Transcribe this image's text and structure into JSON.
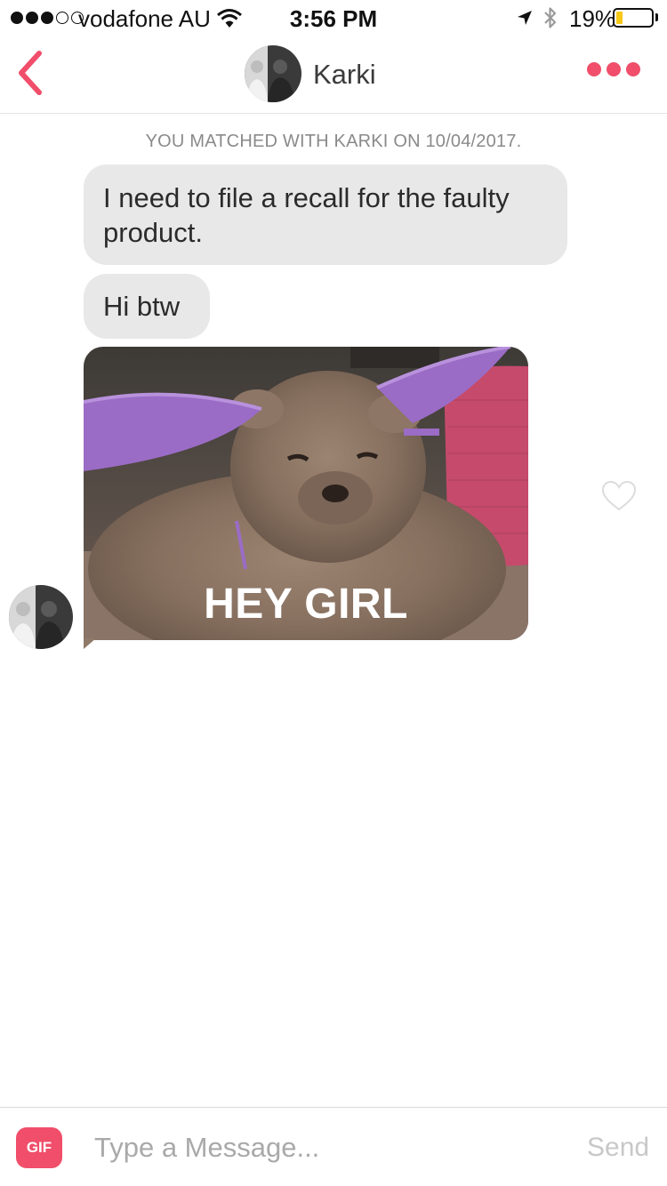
{
  "status_bar": {
    "carrier": "vodafone AU",
    "time": "3:56 PM",
    "battery_percent": "19%",
    "battery_level": 0.19,
    "signal_bars_filled": 3,
    "signal_bars_total": 5
  },
  "header": {
    "back_icon": "chevron-left-icon",
    "name": "Karki",
    "more_icon": "more-dots-icon"
  },
  "conversation": {
    "match_text": "YOU MATCHED WITH KARKI ON 10/04/2017.",
    "messages": [
      {
        "type": "text",
        "text": "I need to file a recall for the faulty product."
      },
      {
        "type": "text",
        "text": "Hi btw"
      },
      {
        "type": "gif",
        "caption": "HEY GIRL"
      }
    ],
    "like_icon": "heart-outline-icon"
  },
  "composer": {
    "gif_label": "GIF",
    "placeholder": "Type a Message...",
    "value": "",
    "send_label": "Send"
  },
  "colors": {
    "accent": "#f04e6a",
    "bubble": "#e8e8e8",
    "meta_text": "#8a8a8a",
    "battery_fill": "#f5c915"
  }
}
